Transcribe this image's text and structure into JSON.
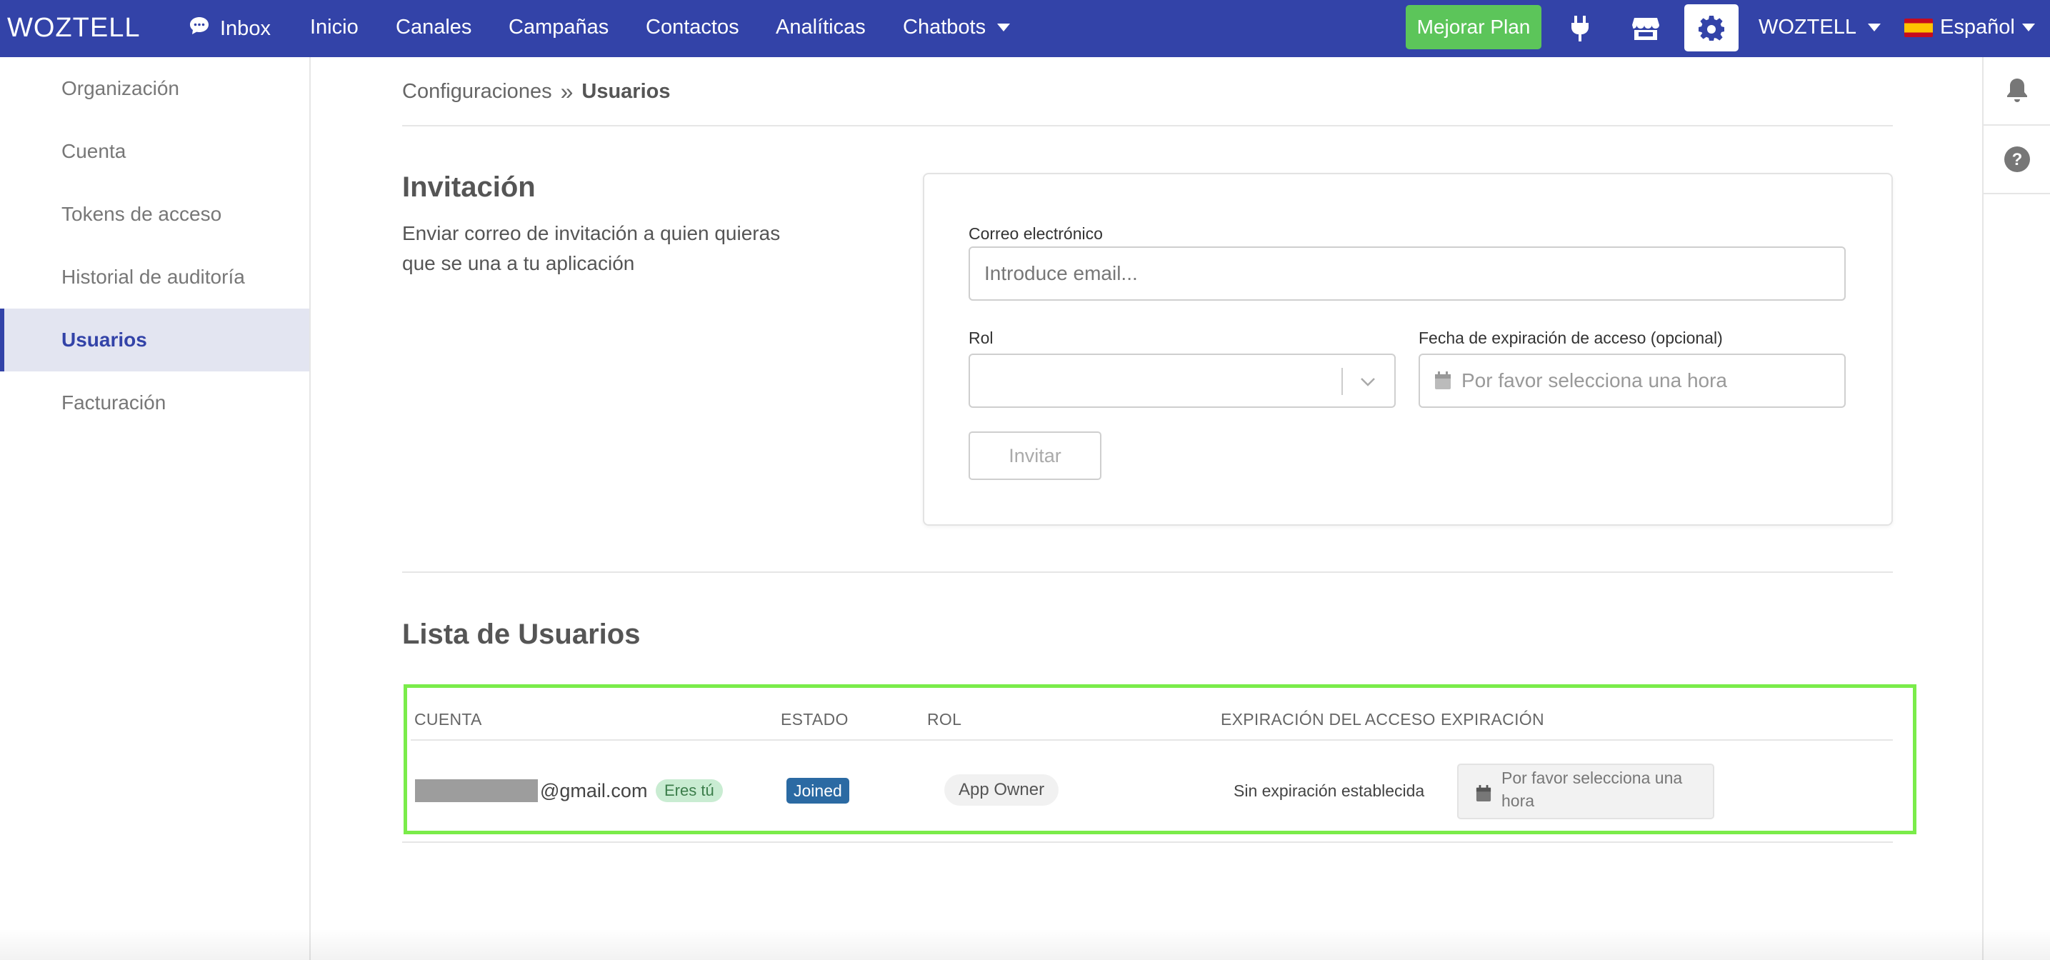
{
  "topbar": {
    "logo": "WOZTELL",
    "nav": [
      {
        "label": "Inbox",
        "icon": "chat-bubble-icon"
      },
      {
        "label": "Inicio"
      },
      {
        "label": "Canales"
      },
      {
        "label": "Campañas"
      },
      {
        "label": "Contactos"
      },
      {
        "label": "Analíticas"
      },
      {
        "label": "Chatbots",
        "dropdown": true
      }
    ],
    "upgrade_label": "Mejorar Plan",
    "account_label": "WOZTELL",
    "language_label": "Español",
    "colors": {
      "bar": "#3343a8",
      "upgrade": "#5cc55a"
    }
  },
  "sidebar": {
    "items": [
      {
        "label": "Organización",
        "active": false
      },
      {
        "label": "Cuenta",
        "active": false
      },
      {
        "label": "Tokens de acceso",
        "active": false
      },
      {
        "label": "Historial de auditoría",
        "active": false
      },
      {
        "label": "Usuarios",
        "active": true
      },
      {
        "label": "Facturación",
        "active": false
      }
    ]
  },
  "breadcrumb": {
    "parent": "Configuraciones",
    "separator": "»",
    "current": "Usuarios"
  },
  "invitation": {
    "title": "Invitación",
    "description": "Enviar correo de invitación a quien quieras que se una a tu aplicación",
    "email_label": "Correo electrónico",
    "email_placeholder": "Introduce email...",
    "role_label": "Rol",
    "role_value": "",
    "expiry_label": "Fecha de expiración de acceso (opcional)",
    "expiry_placeholder": "Por favor selecciona una hora",
    "invite_label": "Invitar"
  },
  "users": {
    "title": "Lista de Usuarios",
    "columns": [
      "CUENTA",
      "ESTADO",
      "ROL",
      "EXPIRACIÓN DEL ACCESO",
      "EXPIRACIÓN"
    ],
    "rows": [
      {
        "email_suffix": "@gmail.com",
        "you_badge": "Eres tú",
        "status": "Joined",
        "role": "App Owner",
        "access_expiry": "Sin expiración establecida",
        "expiry_placeholder_line1": "Por favor selecciona una",
        "expiry_placeholder_line2": "hora"
      }
    ]
  }
}
